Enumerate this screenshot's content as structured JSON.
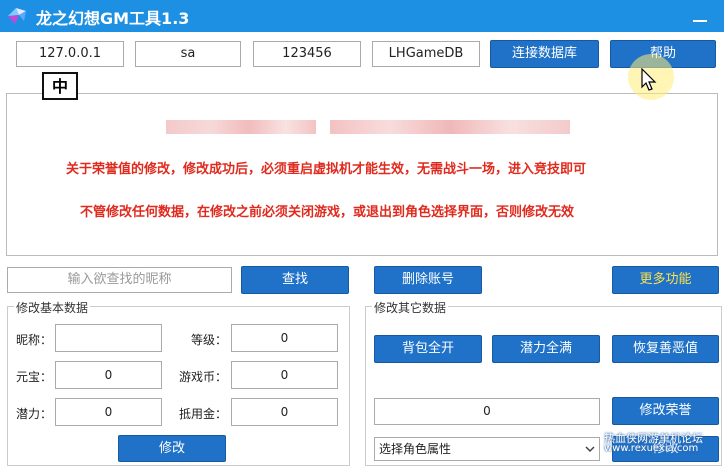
{
  "window": {
    "title": "龙之幻想GM工具1.3"
  },
  "connection": {
    "host": "127.0.0.1",
    "user": "sa",
    "password": "123456",
    "database": "LHGameDB",
    "connect_label": "连接数据库",
    "help_label": "帮助"
  },
  "ime": {
    "label": "中"
  },
  "notice": {
    "line1": "关于荣誉值的修改，修改成功后，必须重启虚拟机才能生效，无需战斗一场，进入竞技即可",
    "line2": "不管修改任何数据，在修改之前必须关闭游戏，或退出到角色选择界面，否则修改无效"
  },
  "search": {
    "placeholder": "输入欲查找的昵称",
    "find_label": "查找",
    "delete_label": "删除账号",
    "more_label": "更多功能"
  },
  "basic": {
    "title": "修改基本数据",
    "nickname_label": "昵称：",
    "nickname_value": "",
    "level_label": "等级：",
    "level_value": "0",
    "yuanbao_label": "元宝：",
    "yuanbao_value": "0",
    "gamecoin_label": "游戏币：",
    "gamecoin_value": "0",
    "potential_label": "潜力：",
    "potential_value": "0",
    "voucher_label": "抵用金：",
    "voucher_value": "0",
    "modify_label": "修改"
  },
  "other": {
    "title": "修改其它数据",
    "bag_label": "背包全开",
    "potential_full_label": "潜力全满",
    "restore_label": "恢复善恶值",
    "honor_value": "0",
    "honor_label": "修改荣誉",
    "attr_select": "选择角色属性",
    "attr_button": "修改"
  },
  "watermark": {
    "line1": "热血侠网游单机论坛",
    "line2": "www.rexuexia.com"
  },
  "colors": {
    "titlebar": "#1e90e4",
    "button": "#1f72c8",
    "more_text": "#ffe14a",
    "notice_red": "#e02a1e"
  }
}
